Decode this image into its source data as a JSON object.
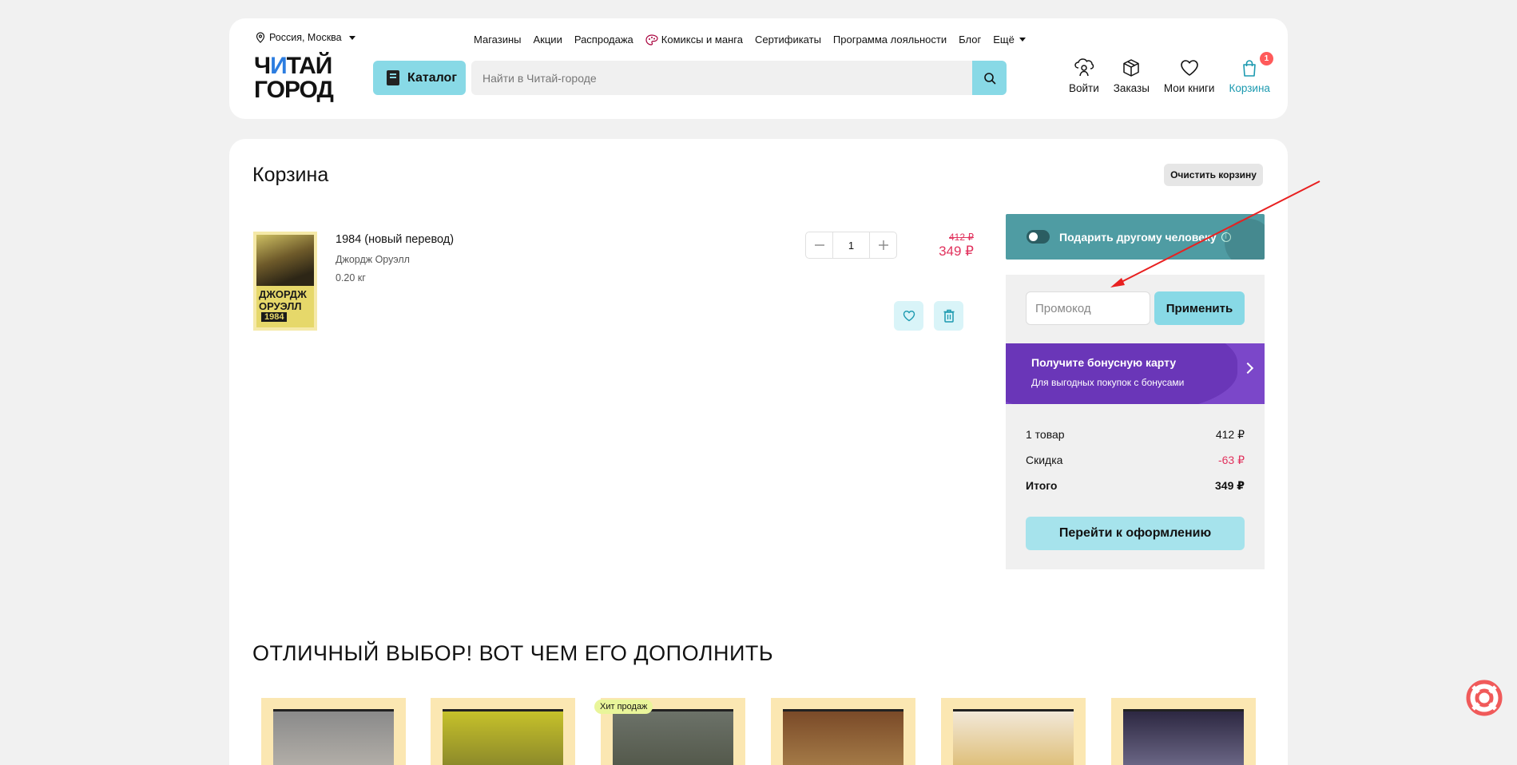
{
  "header": {
    "city": "Россия, Москва",
    "nav": [
      "Магазины",
      "Акции",
      "Распродажа",
      "Комиксы и манга",
      "Сертификаты",
      "Программа лояльности",
      "Блог",
      "Ещё"
    ],
    "logo_line1_a": "Ч",
    "logo_line1_b": "И",
    "logo_line1_c": "ТАЙ",
    "logo_line2": "ГОРОД",
    "catalog_label": "Каталог",
    "search_placeholder": "Найти в Читай-городе",
    "icons": {
      "login": "Войти",
      "orders": "Заказы",
      "my_books": "Мои книги",
      "cart": "Корзина",
      "cart_count": "1"
    }
  },
  "cart": {
    "title": "Корзина",
    "clear_label": "Очистить корзину",
    "item": {
      "title": "1984 (новый перевод)",
      "author": "Джордж Оруэлл",
      "weight": "0.20 кг",
      "cover_author_line1": "ДЖОРДЖ",
      "cover_author_line2": "ОРУЭЛЛ",
      "cover_year": "1984",
      "quantity": "1",
      "old_price": "412 ₽",
      "new_price": "349 ₽"
    }
  },
  "summary": {
    "gift_label": "Подарить другому человеку",
    "promo_placeholder": "Промокод",
    "apply_label": "Применить",
    "bonus_title": "Получите бонусную карту",
    "bonus_subtitle": "Для выгодных покупок с бонусами",
    "rows": [
      {
        "label": "1 товар",
        "value": "412 ₽"
      },
      {
        "label": "Скидка",
        "value": "-63 ₽"
      },
      {
        "label": "Итого",
        "value": "349 ₽"
      }
    ],
    "checkout_label": "Перейти к оформлению"
  },
  "recommendations": {
    "title": "ОТЛИЧНЫЙ ВЫБОР! ВОТ ЧЕМ ЕГО ДОПОЛНИТЬ",
    "hit_badge": "Хит продаж"
  },
  "colors": {
    "accent": "#88d9e6",
    "price": "#e1325d",
    "gift_bg": "#4f9ca3",
    "bonus_bg": "#7b47c9",
    "annotation_arrow": "#e82020"
  }
}
